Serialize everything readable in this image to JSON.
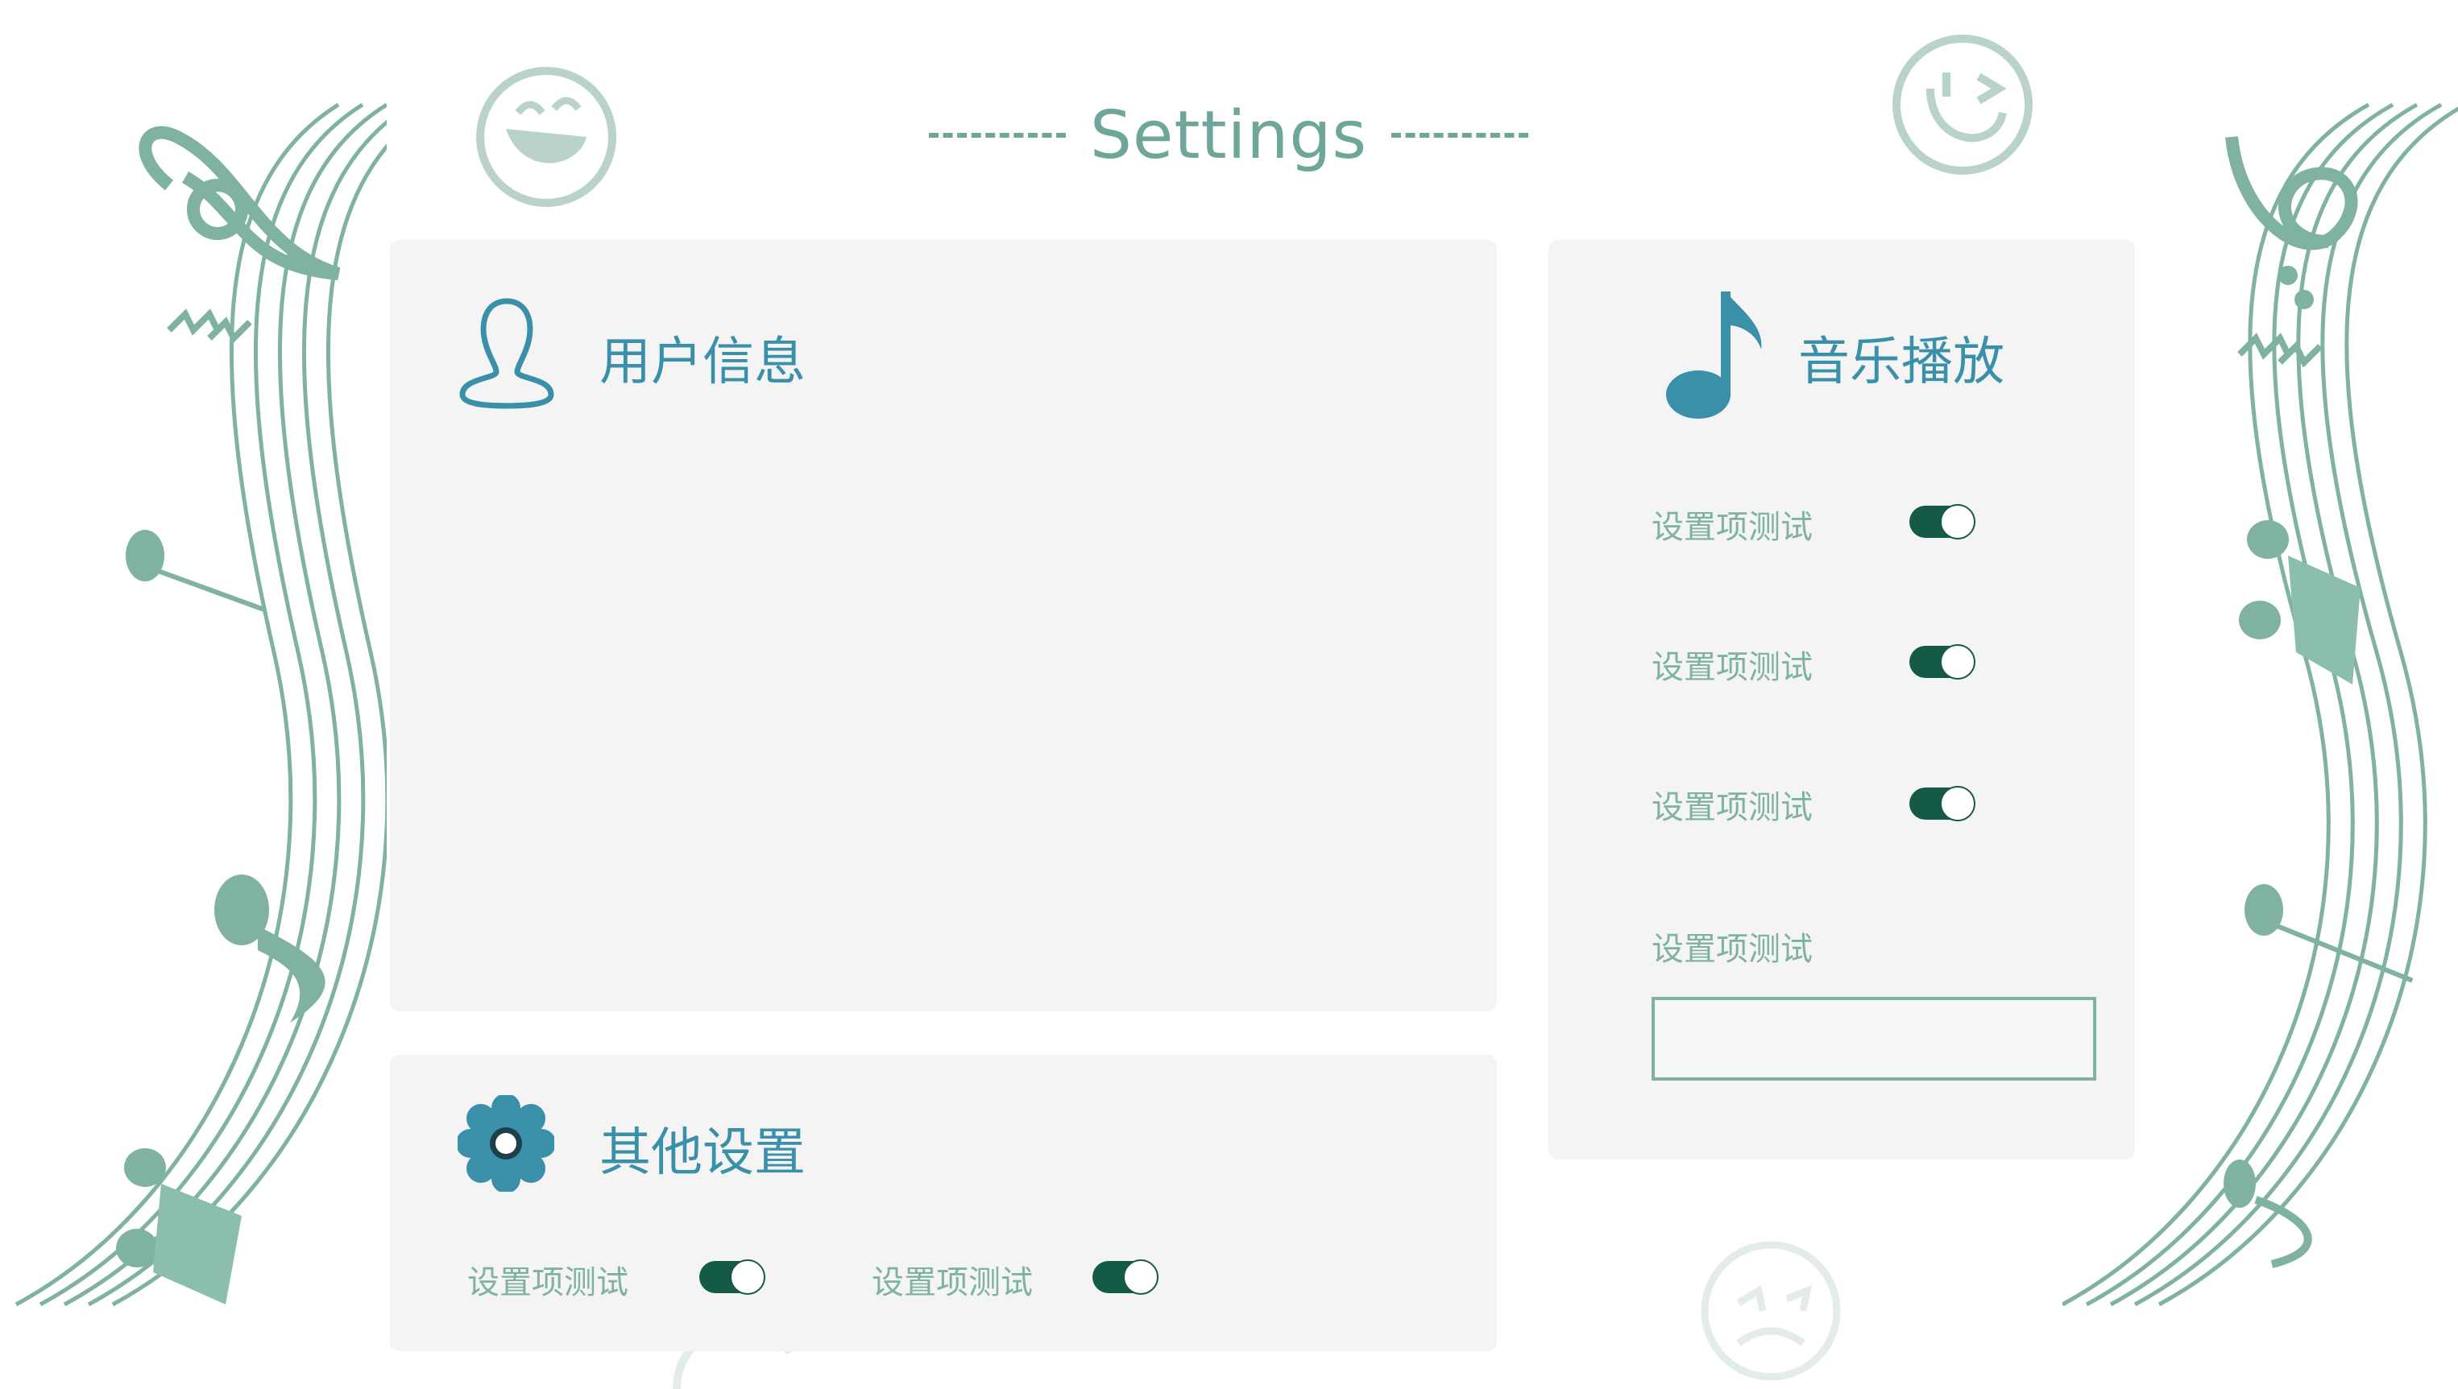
{
  "page": {
    "title": "Settings"
  },
  "user_panel": {
    "title": "用户信息"
  },
  "music_panel": {
    "title": "音乐播放",
    "settings": [
      {
        "label": "设置项测试",
        "toggle_on": true
      },
      {
        "label": "设置项测试",
        "toggle_on": true
      },
      {
        "label": "设置项测试",
        "toggle_on": true
      }
    ],
    "input_label": "设置项测试",
    "input_value": ""
  },
  "other_panel": {
    "title": "其他设置",
    "settings": [
      {
        "label": "设置项测试",
        "toggle_on": true
      },
      {
        "label": "设置项测试",
        "toggle_on": true
      }
    ]
  },
  "colors": {
    "accent_title": "#6ea799",
    "panel_title": "#3a8fa9",
    "toggle_on": "#145a46",
    "panel_bg": "#f4f4f4",
    "label": "#7fb2a3"
  },
  "icons": [
    "user-icon",
    "music-note-icon",
    "gear-icon",
    "laughing-emoji-icon",
    "winking-emoji-icon",
    "angry-emoji-icon",
    "music-staff-decoration"
  ]
}
